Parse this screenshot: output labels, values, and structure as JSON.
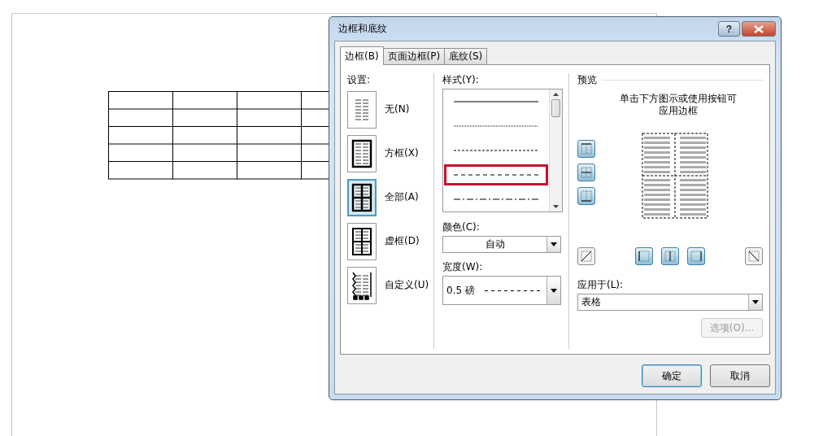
{
  "window": {
    "title": "边框和底纹",
    "help": "?"
  },
  "tabs": [
    {
      "label": "边框(B)",
      "selected": true
    },
    {
      "label": "页面边框(P)",
      "selected": false
    },
    {
      "label": "底纹(S)",
      "selected": false
    }
  ],
  "settings": {
    "label": "设置:",
    "items": [
      {
        "label": "无(N)",
        "kind": "none",
        "selected": false
      },
      {
        "label": "方框(X)",
        "kind": "box",
        "selected": false
      },
      {
        "label": "全部(A)",
        "kind": "all",
        "selected": true
      },
      {
        "label": "虚框(D)",
        "kind": "grid",
        "selected": false
      },
      {
        "label": "自定义(U)",
        "kind": "custom",
        "selected": false
      }
    ]
  },
  "style": {
    "label": "样式(Y):",
    "options": [
      {
        "kind": "solid",
        "selected": false
      },
      {
        "kind": "dotted",
        "selected": false
      },
      {
        "kind": "fine-dash",
        "selected": false
      },
      {
        "kind": "dash",
        "selected": true
      },
      {
        "kind": "dash-dot",
        "selected": false
      }
    ]
  },
  "color": {
    "label": "颜色(C):",
    "value": "自动"
  },
  "width": {
    "label": "宽度(W):",
    "value": "0.5 磅"
  },
  "preview": {
    "label": "预览",
    "hint": "单击下方图示或使用按钮可应用边框",
    "side_buttons": [
      {
        "kind": "top",
        "on": true
      },
      {
        "kind": "middle",
        "on": true
      },
      {
        "kind": "bottom",
        "on": true
      }
    ],
    "bottom_buttons": [
      {
        "kind": "diag-up",
        "on": false
      },
      {
        "kind": "left",
        "on": true
      },
      {
        "kind": "center",
        "on": true
      },
      {
        "kind": "right",
        "on": true
      },
      {
        "kind": "diag-down",
        "on": false
      }
    ]
  },
  "apply_to": {
    "label": "应用于(L):",
    "value": "表格"
  },
  "options_button": {
    "label": "选项(O)...",
    "disabled": true
  },
  "buttons": [
    {
      "label": "确定",
      "kind": "default"
    },
    {
      "label": "取消",
      "kind": "normal"
    }
  ]
}
